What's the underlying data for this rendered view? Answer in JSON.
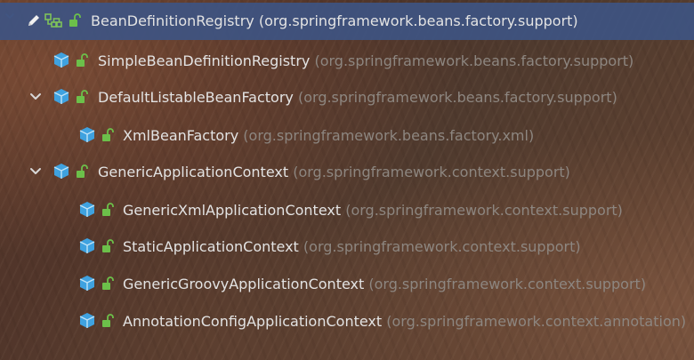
{
  "tree": {
    "rows": [
      {
        "name": "BeanDefinitionRegistry",
        "package": "(org.springframework.beans.factory.support)",
        "kind": "interface",
        "expanded": true,
        "selected": true
      },
      {
        "name": "SimpleBeanDefinitionRegistry",
        "package": "(org.springframework.beans.factory.support)",
        "kind": "class",
        "expanded": false,
        "selected": false
      },
      {
        "name": "DefaultListableBeanFactory",
        "package": "(org.springframework.beans.factory.support)",
        "kind": "class",
        "expanded": true,
        "selected": false
      },
      {
        "name": "XmlBeanFactory",
        "package": "(org.springframework.beans.factory.xml)",
        "kind": "class",
        "expanded": false,
        "selected": false
      },
      {
        "name": "GenericApplicationContext",
        "package": "(org.springframework.context.support)",
        "kind": "class",
        "expanded": true,
        "selected": false
      },
      {
        "name": "GenericXmlApplicationContext",
        "package": "(org.springframework.context.support)",
        "kind": "class",
        "expanded": false,
        "selected": false
      },
      {
        "name": "StaticApplicationContext",
        "package": "(org.springframework.context.support)",
        "kind": "class",
        "expanded": false,
        "selected": false
      },
      {
        "name": "GenericGroovyApplicationContext",
        "package": "(org.springframework.context.support)",
        "kind": "class",
        "expanded": false,
        "selected": false
      },
      {
        "name": "AnnotationConfigApplicationContext",
        "package": "(org.springframework.context.annotation)",
        "kind": "class",
        "expanded": false,
        "selected": false
      }
    ]
  },
  "colors": {
    "selection": "#3e5482",
    "class_icon": "#3fa2e0",
    "lock_icon": "#57a64a",
    "name_text": "#e3e3e3",
    "package_text": "#8d8680",
    "arrow": "#d8d8d8"
  },
  "icons": {
    "edit": "pencil-icon",
    "interface": "interface-hierarchy-icon",
    "class": "cube-class-icon",
    "lock": "open-lock-icon",
    "expand": "chevron-down-icon"
  }
}
